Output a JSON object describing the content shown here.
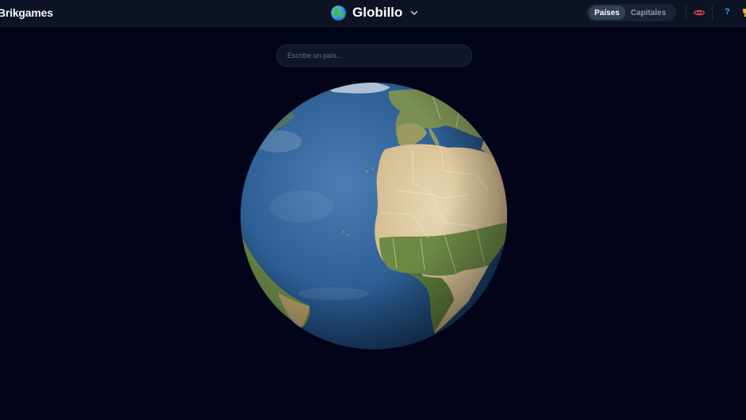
{
  "header": {
    "brand": "Brikgames",
    "app_title": "Globillo",
    "app_icon": "globe-europe-africa-icon",
    "modes": [
      {
        "label": "Países",
        "active": true
      },
      {
        "label": "Capitales",
        "active": false
      }
    ],
    "eye_icon_color": "#e5484d",
    "help_label": "?",
    "help_color": "#3b9cff"
  },
  "search": {
    "placeholder": "Escribe un país...",
    "value": ""
  },
  "globe": {
    "view": "Atlantic Ocean, Africa and Europe",
    "ocean_color": "#2d5f95",
    "land_color": "#d8c29a"
  },
  "colors": {
    "background": "#02051a",
    "topbar": "#0d1324"
  }
}
